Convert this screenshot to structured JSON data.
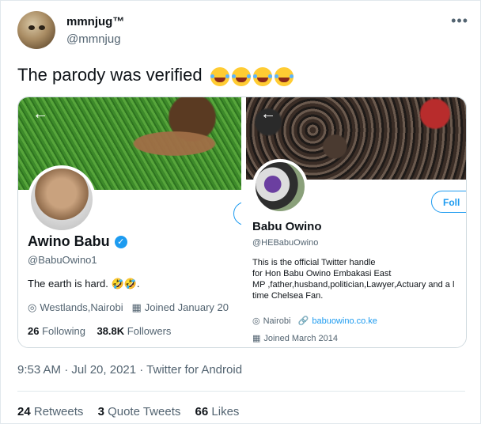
{
  "tweet": {
    "display_name": "mmnjug™",
    "handle": "@mmnjug",
    "more_icon": "•••",
    "text": "The parody was verified",
    "emoji_count": 4,
    "timestamp_line": "9:53 AM · Jul 20, 2021 · Twitter for Android",
    "stats": {
      "retweets_count": "24",
      "retweets_label": "Retweets",
      "quotes_count": "3",
      "quotes_label": "Quote Tweets",
      "likes_count": "66",
      "likes_label": "Likes"
    }
  },
  "profile_left": {
    "back_icon": "←",
    "name": "Awino Babu",
    "verified_icon": "✓",
    "handle": "@BabuOwino1",
    "bio": "The earth is hard. 🤣🤣.",
    "location_icon": "◎",
    "location": "Westlands,Nairobi",
    "joined_icon": "▦",
    "joined": "Joined January 20",
    "following_count": "26",
    "following_label": "Following",
    "followers_count": "38.8K",
    "followers_label": "Followers"
  },
  "profile_right": {
    "back_icon": "←",
    "follow_label": "Foll",
    "name": "Babu Owino",
    "handle": "@HEBabuOwino",
    "bio_line1": "This is the official Twitter handle",
    "bio_line2": "for Hon Babu Owino Embakasi East",
    "bio_line3": "MP ,father,husband,politician,Lawyer,Actuary and a l",
    "bio_line4": "time Chelsea Fan.",
    "location_icon": "◎",
    "location": "Nairobi",
    "link_icon": "🔗",
    "website": "babuowino.co.ke",
    "joined_icon": "▦",
    "joined": "Joined March 2014"
  }
}
